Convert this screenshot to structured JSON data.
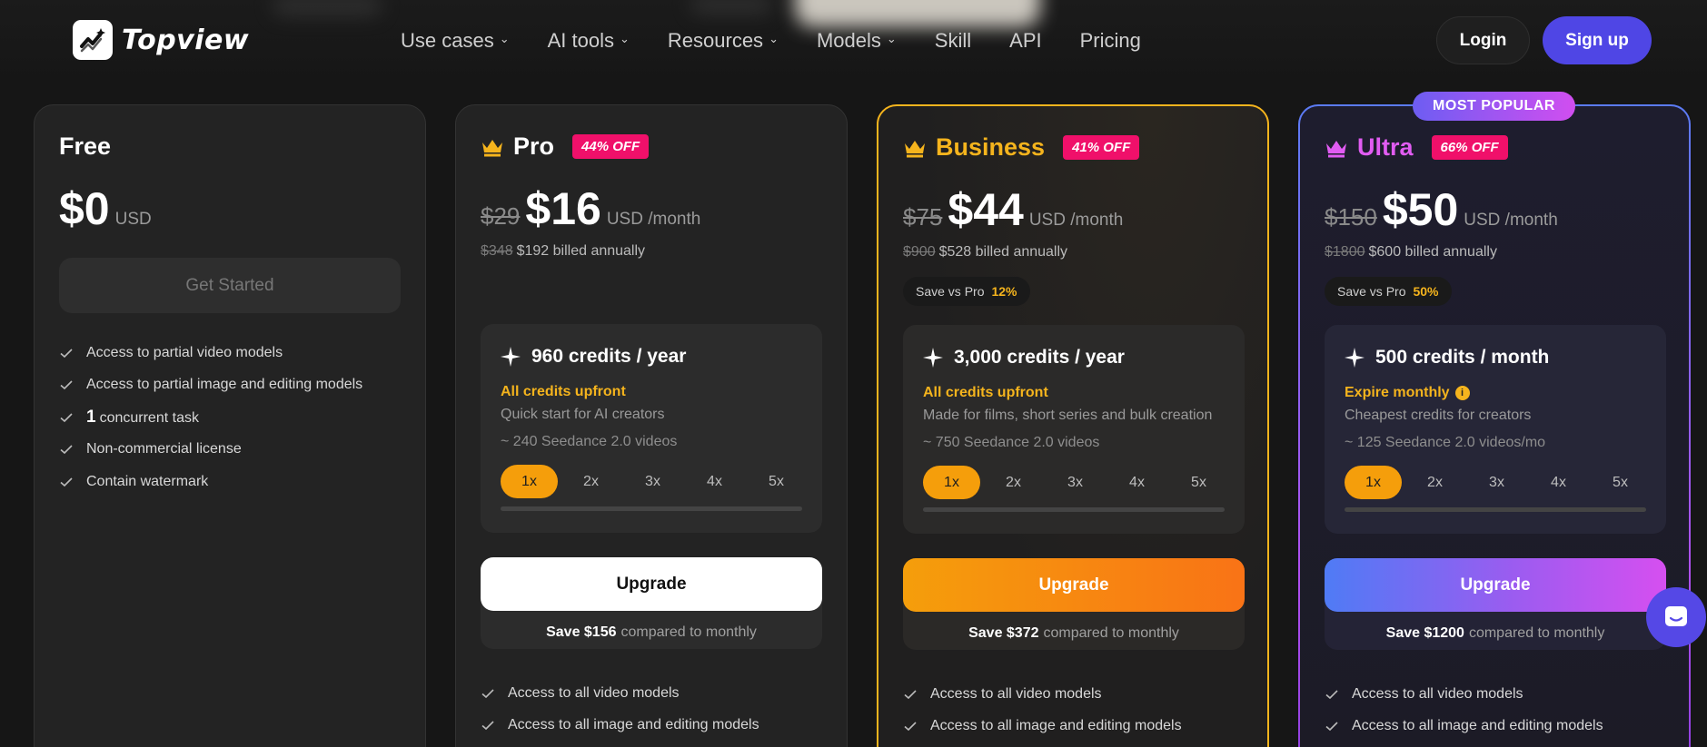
{
  "nav": {
    "logo_text": "Topview",
    "links": [
      {
        "label": "Use cases",
        "dropdown": true
      },
      {
        "label": "AI tools",
        "dropdown": true
      },
      {
        "label": "Resources",
        "dropdown": true
      },
      {
        "label": "Models",
        "dropdown": true
      },
      {
        "label": "Skill",
        "dropdown": false
      },
      {
        "label": "API",
        "dropdown": false
      },
      {
        "label": "Pricing",
        "dropdown": false
      }
    ],
    "login_label": "Login",
    "signup_label": "Sign up"
  },
  "popular_badge": "MOST POPULAR",
  "plans": {
    "free": {
      "name": "Free",
      "price": "$0",
      "unit": "USD",
      "cta": "Get Started",
      "features": [
        {
          "num": "",
          "text": "Access to partial video models"
        },
        {
          "num": "",
          "text": "Access to partial image and editing models"
        },
        {
          "num": "1",
          "text": "concurrent task"
        },
        {
          "num": "",
          "text": "Non-commercial license"
        },
        {
          "num": "",
          "text": "Contain watermark"
        }
      ]
    },
    "pro": {
      "name": "Pro",
      "discount": "44% OFF",
      "old_price": "$29",
      "price": "$16",
      "unit": "USD /month",
      "billed_old": "$348",
      "billed": "$192 billed annually",
      "credits_title": "960 credits / year",
      "credits_note": "All credits upfront",
      "credits_desc": "Quick start for AI creators",
      "credits_sub": "~ 240 Seedance 2.0 videos",
      "multipliers": [
        "1x",
        "2x",
        "3x",
        "4x",
        "5x"
      ],
      "cta": "Upgrade",
      "save_amount": "Save $156",
      "save_text": "compared to monthly",
      "features": [
        {
          "num": "",
          "text": "Access to all video models"
        },
        {
          "num": "",
          "text": "Access to all image and editing models"
        }
      ]
    },
    "business": {
      "name": "Business",
      "discount": "41% OFF",
      "old_price": "$75",
      "price": "$44",
      "unit": "USD /month",
      "billed_old": "$900",
      "billed": "$528 billed annually",
      "save_vs_label": "Save vs Pro",
      "save_vs_value": "12%",
      "credits_title": "3,000 credits / year",
      "credits_note": "All credits upfront",
      "credits_desc": "Made for films, short series and bulk creation",
      "credits_sub": "~ 750 Seedance 2.0 videos",
      "multipliers": [
        "1x",
        "2x",
        "3x",
        "4x",
        "5x"
      ],
      "cta": "Upgrade",
      "save_amount": "Save $372",
      "save_text": "compared to monthly",
      "features": [
        {
          "num": "",
          "text": "Access to all video models"
        },
        {
          "num": "",
          "text": "Access to all image and editing models"
        }
      ]
    },
    "ultra": {
      "name": "Ultra",
      "discount": "66% OFF",
      "old_price": "$150",
      "price": "$50",
      "unit": "USD /month",
      "billed_old": "$1800",
      "billed": "$600 billed annually",
      "save_vs_label": "Save vs Pro",
      "save_vs_value": "50%",
      "credits_title": "500 credits / month",
      "credits_note": "Expire monthly",
      "credits_desc": "Cheapest credits for creators",
      "credits_sub": "~ 125 Seedance 2.0 videos/mo",
      "multipliers": [
        "1x",
        "2x",
        "3x",
        "4x",
        "5x"
      ],
      "cta": "Upgrade",
      "save_amount": "Save $1200",
      "save_text": "compared to monthly",
      "features": [
        {
          "num": "",
          "text": "Access to all video models"
        },
        {
          "num": "",
          "text": "Access to all image and editing models"
        }
      ]
    }
  },
  "colors": {
    "accent_purple": "#4f46e5",
    "business_gold": "#f5b41d",
    "ultra_pink": "#e15cf2",
    "discount_pink": "#f0106a"
  }
}
